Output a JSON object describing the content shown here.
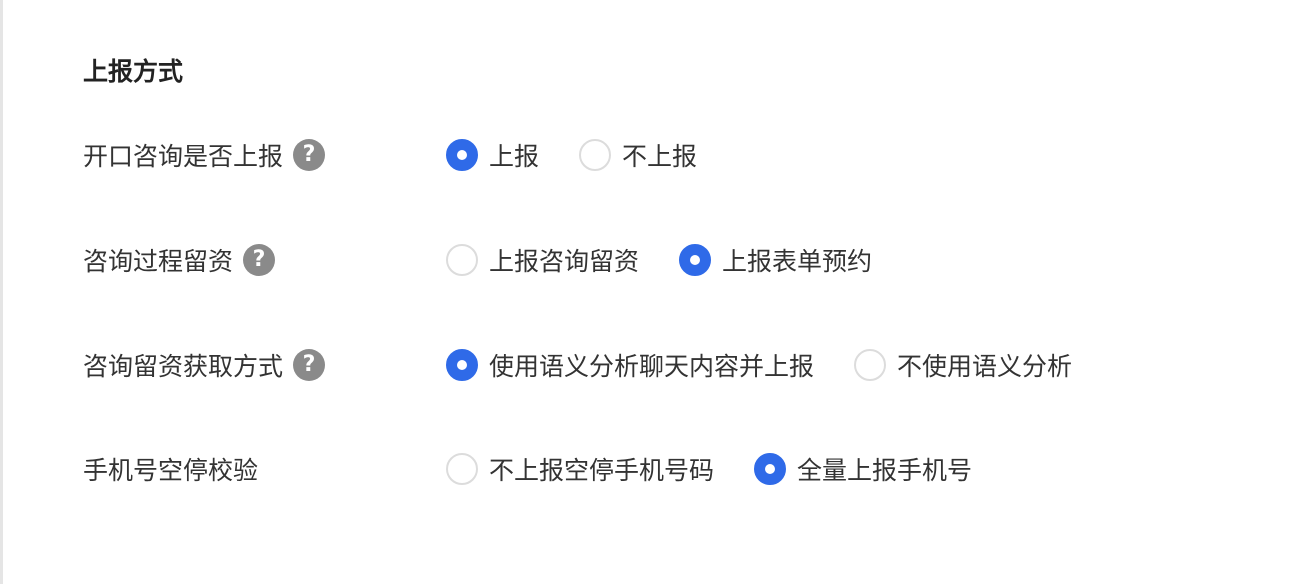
{
  "section": {
    "title": "上报方式"
  },
  "rows": [
    {
      "label": "开口咨询是否上报",
      "has_help": true,
      "help_glyph": "?",
      "options": [
        {
          "label": "上报",
          "checked": true
        },
        {
          "label": "不上报",
          "checked": false
        }
      ]
    },
    {
      "label": "咨询过程留资",
      "has_help": true,
      "help_glyph": "?",
      "options": [
        {
          "label": "上报咨询留资",
          "checked": false
        },
        {
          "label": "上报表单预约",
          "checked": true
        }
      ]
    },
    {
      "label": "咨询留资获取方式",
      "has_help": true,
      "help_glyph": "?",
      "options": [
        {
          "label": "使用语义分析聊天内容并上报",
          "checked": true
        },
        {
          "label": "不使用语义分析",
          "checked": false
        }
      ]
    },
    {
      "label": "手机号空停校验",
      "has_help": false,
      "options": [
        {
          "label": "不上报空停手机号码",
          "checked": false
        },
        {
          "label": "全量上报手机号",
          "checked": true
        }
      ]
    }
  ],
  "colors": {
    "accent": "#2f6ae8",
    "help_icon": "#8a8a8a",
    "radio_border": "#dcdcdc",
    "text": "#333333"
  }
}
